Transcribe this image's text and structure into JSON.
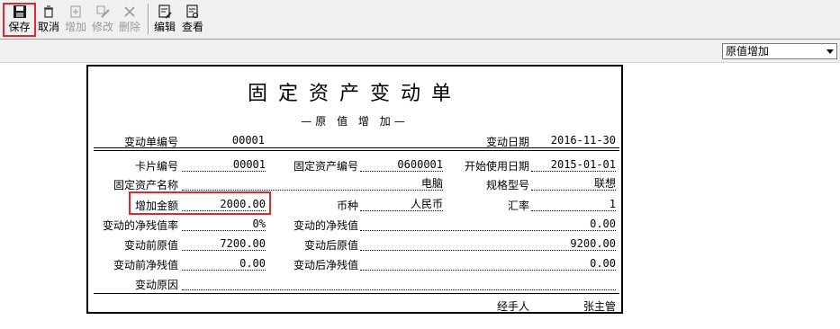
{
  "toolbar": {
    "save": "保存",
    "cancel": "取消",
    "add": "增加",
    "modify": "修改",
    "delete": "删除",
    "edit": "编辑",
    "view": "查看"
  },
  "change_type_select": {
    "value": "原值增加"
  },
  "doc": {
    "title": "固定资产变动单",
    "subtitle": "—原 值 增 加—",
    "change_no_label": "变动单编号",
    "change_no": "00001",
    "change_date_label": "变动日期",
    "change_date": "2016-11-30",
    "card_no_label": "卡片编号",
    "card_no": "00001",
    "asset_no_label": "固定资产编号",
    "asset_no": "0600001",
    "start_date_label": "开始使用日期",
    "start_date": "2015-01-01",
    "asset_name_label": "固定资产名称",
    "asset_name": "电脑",
    "model_label": "规格型号",
    "model": "联想",
    "increase_label": "增加金额",
    "increase": "2000.00",
    "currency_label": "币种",
    "currency": "人民币",
    "rate_label": "汇率",
    "rate": "1",
    "net_rate_label": "变动的净残值率",
    "net_rate": "0%",
    "net_value_label": "变动的净残值",
    "net_value": "0.00",
    "orig_before_label": "变动前原值",
    "orig_before": "7200.00",
    "orig_after_label": "变动后原值",
    "orig_after": "9200.00",
    "net_before_label": "变动前净残值",
    "net_before": "0.00",
    "net_after_label": "变动后净残值",
    "net_after": "0.00",
    "reason_label": "变动原因",
    "reason": "",
    "handler_label": "经手人",
    "handler": "张主管"
  }
}
